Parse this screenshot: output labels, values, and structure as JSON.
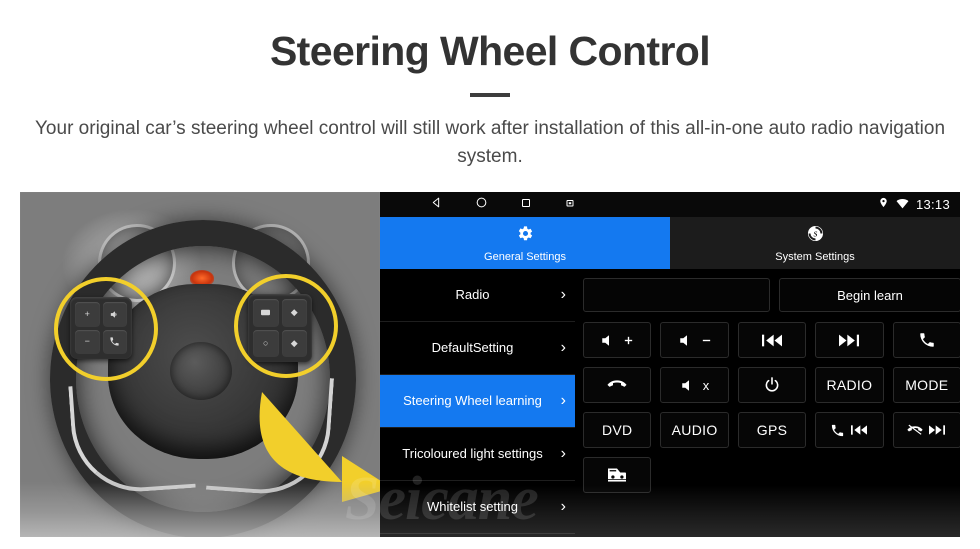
{
  "header": {
    "title": "Steering Wheel Control",
    "subtitle": "Your original car’s steering wheel control will still work after installation of this all-in-one auto radio navigation system."
  },
  "colors": {
    "accent_blue": "#1479F0",
    "highlight_yellow": "#F2CF2B",
    "unit_background": "#000000",
    "title_color": "#333333"
  },
  "photo": {
    "alt": "grayscale steering wheel with highlighted control clusters",
    "highlight_circles": 2,
    "arrow": "yellow-curved-arrow-right",
    "left_cluster_keys": [
      "+",
      "-",
      "voice",
      "phone"
    ],
    "right_cluster_keys": [
      "media",
      "up",
      "circle",
      "down"
    ]
  },
  "statusbar": {
    "back": "back-icon",
    "home": "home-icon",
    "recents": "recents-icon",
    "screenshot": "screenshot-icon",
    "location": "location-pin-icon",
    "wifi": "wifi-icon",
    "time": "13:13"
  },
  "tabs": [
    {
      "label": "General Settings",
      "icon": "gear-icon",
      "active": true
    },
    {
      "label": "System Settings",
      "icon": "seicane-logo-icon",
      "active": false
    }
  ],
  "sidebar": {
    "items": [
      {
        "label": "Radio",
        "active": false
      },
      {
        "label": "DefaultSetting",
        "active": false
      },
      {
        "label": "Steering Wheel learning",
        "active": true
      },
      {
        "label": "Tricoloured light settings",
        "active": false
      },
      {
        "label": "Whitelist setting",
        "active": false
      }
    ],
    "chevron": "›"
  },
  "content": {
    "display_field_value": "",
    "begin_learn_label": "Begin learn",
    "buttons": [
      {
        "name": "volume-up",
        "icon": "volume-up-icon",
        "label": ""
      },
      {
        "name": "volume-down",
        "icon": "volume-down-icon",
        "label": ""
      },
      {
        "name": "previous-track",
        "icon": "previous-track-icon",
        "label": ""
      },
      {
        "name": "next-track",
        "icon": "next-track-icon",
        "label": ""
      },
      {
        "name": "answer-call",
        "icon": "phone-answer-icon",
        "label": ""
      },
      {
        "name": "hang-up",
        "icon": "phone-hangup-icon",
        "label": ""
      },
      {
        "name": "mute",
        "icon": "volume-mute-icon",
        "label": ""
      },
      {
        "name": "power",
        "icon": "power-icon",
        "label": ""
      },
      {
        "name": "radio",
        "icon": "",
        "label": "RADIO"
      },
      {
        "name": "mode",
        "icon": "",
        "label": "MODE"
      },
      {
        "name": "dvd",
        "icon": "",
        "label": "DVD"
      },
      {
        "name": "audio",
        "icon": "",
        "label": "AUDIO"
      },
      {
        "name": "gps",
        "icon": "",
        "label": "GPS"
      },
      {
        "name": "call-previous",
        "icon": "phone-previous-icon",
        "label": ""
      },
      {
        "name": "hangup-next",
        "icon": "hangup-next-icon",
        "label": ""
      },
      {
        "name": "vehicle-info",
        "icon": "car-icon",
        "label": ""
      }
    ]
  },
  "watermark": {
    "text": "Seicane"
  }
}
